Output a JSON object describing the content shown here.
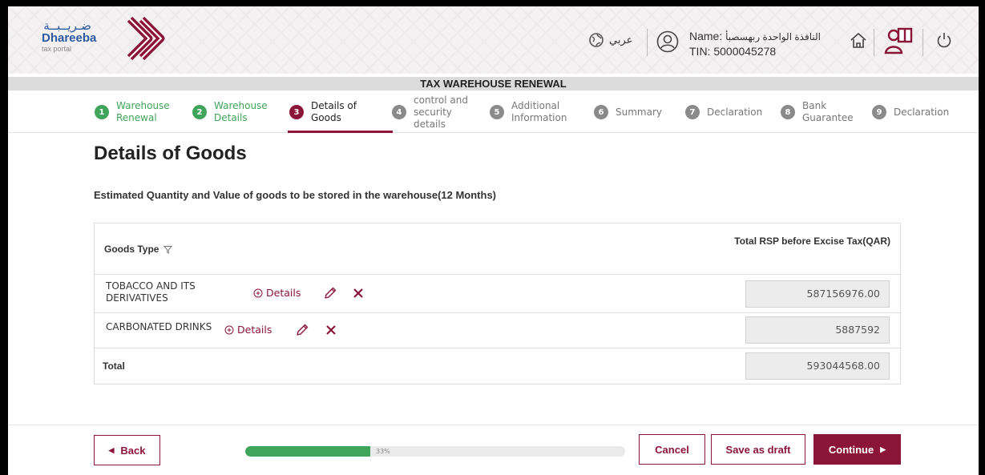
{
  "header": {
    "brand_arabic": "ضـريــبــة",
    "brand_name": "Dhareeba",
    "brand_sub": "tax portal",
    "language_label": "عربي",
    "user_name_label": "Name:",
    "user_name_value": "النافذة الواحدة ربهسصبأ",
    "tin": "TIN: 5000045278",
    "icons": [
      "globe-icon",
      "user-icon",
      "home-icon",
      "help-book-icon",
      "power-icon"
    ]
  },
  "title_bar": "TAX WAREHOUSE RENEWAL",
  "steps": [
    {
      "num": "1",
      "label": "Warehouse Renewal",
      "state": "done"
    },
    {
      "num": "2",
      "label": "Warehouse Details",
      "state": "done"
    },
    {
      "num": "3",
      "label": "Details of Goods",
      "state": "active"
    },
    {
      "num": "4",
      "label": "control and security details",
      "state": "pending"
    },
    {
      "num": "5",
      "label": "Additional Information",
      "state": "pending"
    },
    {
      "num": "6",
      "label": "Summary",
      "state": "pending"
    },
    {
      "num": "7",
      "label": "Declaration",
      "state": "pending"
    },
    {
      "num": "8",
      "label": "Bank Guarantee",
      "state": "pending"
    },
    {
      "num": "9",
      "label": "Declaration",
      "state": "pending"
    }
  ],
  "main": {
    "page_title": "Details of Goods",
    "subtitle": "Estimated Quantity and Value of goods to be stored in the warehouse(12 Months)",
    "table": {
      "col_goods": "Goods Type",
      "col_rsp": "Total RSP before Excise Tax(QAR)",
      "rows": [
        {
          "goods": "TOBACCO AND ITS DERIVATIVES",
          "details_label": "Details",
          "amount": "587156976.00"
        },
        {
          "goods": "CARBONATED DRINKS",
          "details_label": "Details",
          "amount": "5887592"
        }
      ],
      "total_label": "Total",
      "total_amount": "593044568.00"
    }
  },
  "footer": {
    "back_label": "Back",
    "progress_percent": 33,
    "progress_text": "33%",
    "cancel_label": "Cancel",
    "save_draft_label": "Save as draft",
    "continue_label": "Continue"
  },
  "colors": {
    "brand": "#8b1538",
    "success": "#3fa55a",
    "logo_blue": "#2b5aa0"
  }
}
